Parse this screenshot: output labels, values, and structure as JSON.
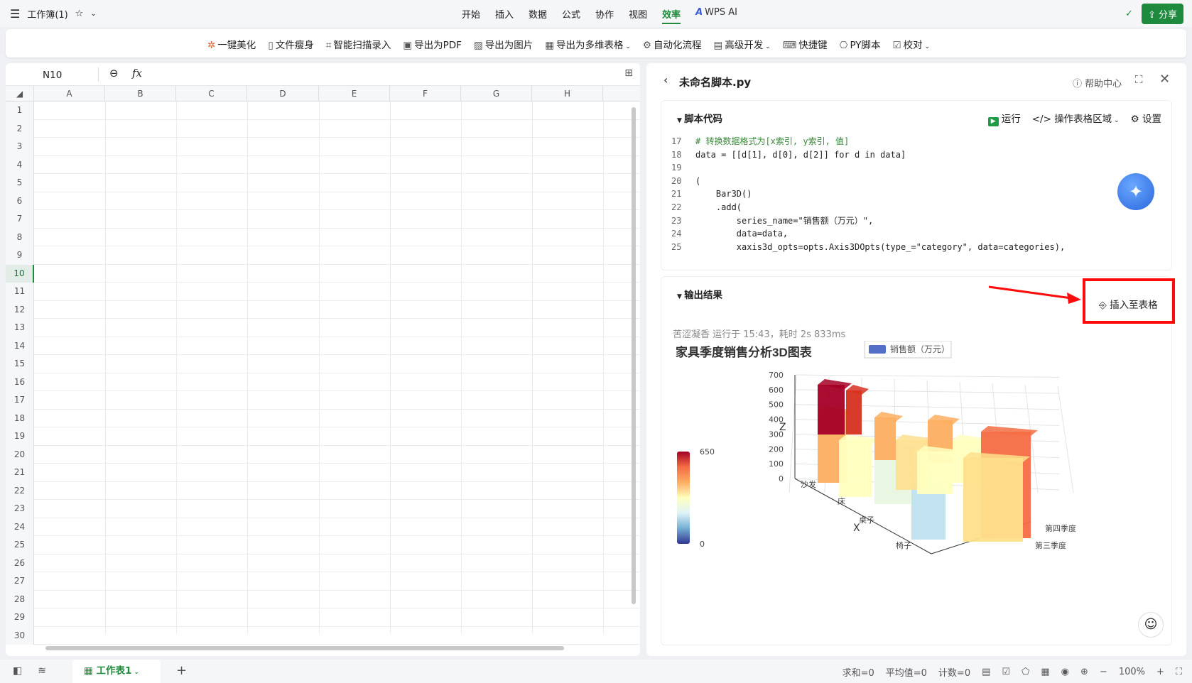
{
  "topbar": {
    "menu_icon": "hamburger-icon",
    "workbook_title": "工作簿(1)",
    "star_icon": "star-icon",
    "menu_items": [
      "开始",
      "插入",
      "数据",
      "公式",
      "协作",
      "视图",
      "效率"
    ],
    "active_menu": "效率",
    "wps_ai_label": "WPS AI",
    "share_label": "分享"
  },
  "ribbon": {
    "items": [
      {
        "label": "一键美化",
        "icon": "beautify-icon"
      },
      {
        "label": "文件瘦身",
        "icon": "file-slim-icon"
      },
      {
        "label": "智能扫描录入",
        "icon": "scan-icon"
      },
      {
        "label": "导出为PDF",
        "icon": "pdf-icon"
      },
      {
        "label": "导出为图片",
        "icon": "image-icon"
      },
      {
        "label": "导出为多维表格",
        "icon": "table-icon",
        "dropdown": true
      },
      {
        "label": "自动化流程",
        "icon": "robot-icon"
      },
      {
        "label": "高级开发",
        "icon": "dev-icon",
        "dropdown": true
      },
      {
        "label": "快捷键",
        "icon": "keyboard-icon"
      },
      {
        "label": "PY脚本",
        "icon": "python-icon"
      },
      {
        "label": "校对",
        "icon": "proofread-icon",
        "dropdown": true
      }
    ]
  },
  "sheet": {
    "name_box": "N10",
    "fx_label": "fx",
    "columns": [
      "A",
      "B",
      "C",
      "D",
      "E",
      "F",
      "G",
      "H"
    ],
    "rows": [
      "1",
      "2",
      "3",
      "4",
      "5",
      "6",
      "7",
      "8",
      "9",
      "10",
      "11",
      "12",
      "13",
      "14",
      "15",
      "16",
      "17",
      "18",
      "19",
      "20",
      "21",
      "22",
      "23",
      "24",
      "25",
      "26",
      "27",
      "28",
      "29",
      "30"
    ],
    "selected_row": "10"
  },
  "panel": {
    "title": "未命名脚本.py",
    "help_label": "帮助中心",
    "code_section_title": "脚本代码",
    "run_label": "运行",
    "range_label": "操作表格区域",
    "settings_label": "设置",
    "code_lines": [
      {
        "n": "17",
        "text": "# 转换数据格式为[x索引, y索引, 值]"
      },
      {
        "n": "18",
        "text": "data = [[d[1], d[0], d[2]] for d in data]"
      },
      {
        "n": "19",
        "text": ""
      },
      {
        "n": "20",
        "text": "("
      },
      {
        "n": "21",
        "text": "    Bar3D()"
      },
      {
        "n": "22",
        "text": "    .add("
      },
      {
        "n": "23",
        "text": "        series_name=\"销售额（万元）\","
      },
      {
        "n": "24",
        "text": "        data=data,"
      },
      {
        "n": "25",
        "text": "        xaxis3d_opts=opts.Axis3DOpts(type_=\"category\", data=categories),"
      }
    ],
    "output_section_title": "输出结果",
    "insert_label": "插入至表格",
    "run_meta": "苦涩凝香 运行于 15:43，耗时 2s 833ms"
  },
  "chart_data": {
    "type": "bar3d",
    "title": "家具季度销售分析3D图表",
    "legend": [
      "销售额（万元）"
    ],
    "legend_color": "#5470c6",
    "x_categories": [
      "沙发",
      "床",
      "桌子",
      "椅子"
    ],
    "y_categories": [
      "第三季度",
      "第四季度"
    ],
    "zlabel": "Z",
    "xlabel": "X",
    "z_ticks": [
      0,
      100,
      200,
      300,
      400,
      500,
      600,
      700
    ],
    "zlim": [
      0,
      700
    ],
    "visual_map": {
      "min": 0,
      "max": 650,
      "colors": [
        "#313695",
        "#74add1",
        "#e0f3f8",
        "#ffffbf",
        "#fdae61",
        "#f46d43",
        "#a50026"
      ]
    }
  },
  "statusbar": {
    "sheet_tab": "工作表1",
    "sum": "求和=0",
    "avg": "平均值=0",
    "count": "计数=0",
    "zoom": "100%"
  }
}
